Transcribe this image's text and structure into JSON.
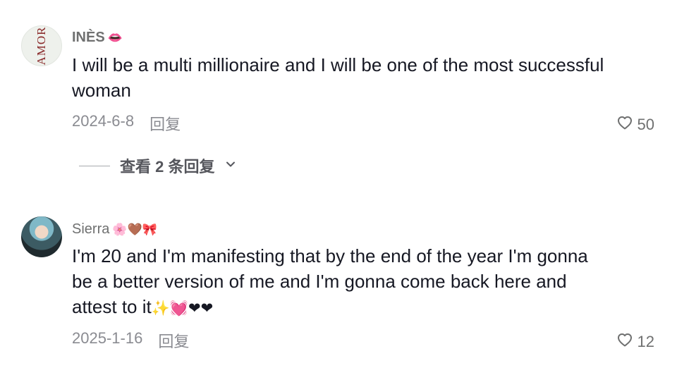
{
  "comments": [
    {
      "avatar_logo": "AMOR",
      "username": "INÈS",
      "username_emojis": "👄",
      "text": "I will be a multi millionaire and I will be one of the most successful woman",
      "date": "2024-6-8",
      "reply_label": "回复",
      "likes": "50",
      "view_replies_label": "查看 2 条回复"
    },
    {
      "username": "Sierra",
      "username_emojis": "🌸🤎🎀",
      "text": "I'm 20 and I'm manifesting that by the end of the year I'm gonna be a better version of me and I'm gonna come back here and attest to it",
      "text_emojis": "✨💓❤❤",
      "date": "2025-1-16",
      "reply_label": "回复",
      "likes": "12"
    }
  ],
  "colors": {
    "text_primary": "#161823",
    "text_secondary": "#8a8b91",
    "username": "#6f7070"
  },
  "icons": {
    "like": "heart-outline-icon",
    "expand": "chevron-down-icon"
  }
}
